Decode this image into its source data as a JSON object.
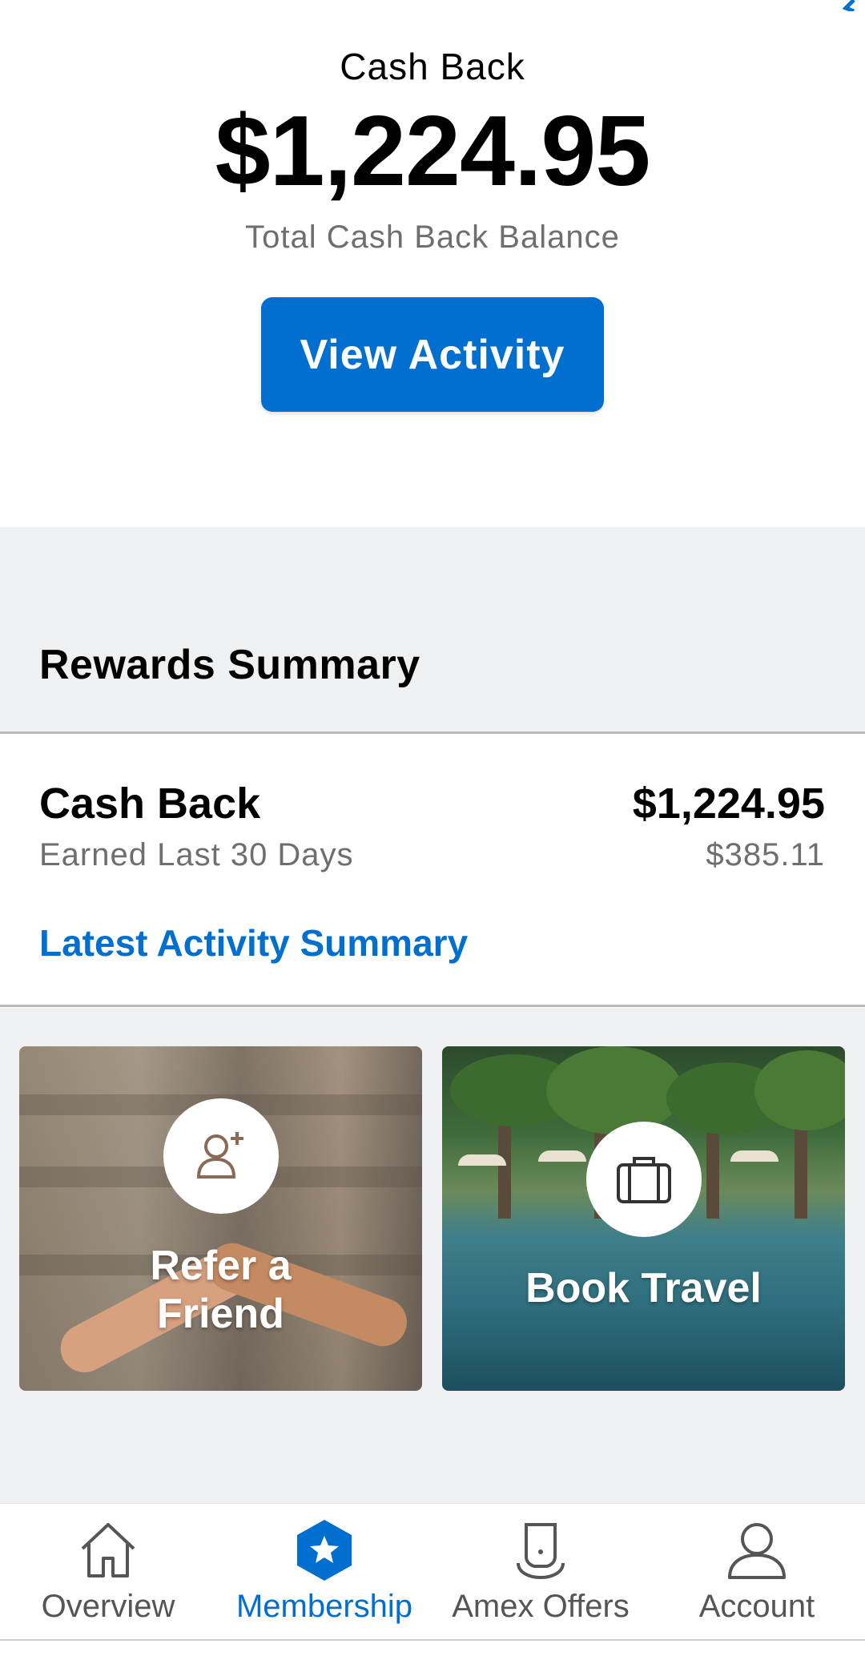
{
  "header": {
    "title": "Cash Back",
    "balance": "$1,224.95",
    "balance_caption": "Total Cash Back Balance",
    "view_activity_label": "View Activity"
  },
  "rewards_summary": {
    "title": "Rewards Summary",
    "cash_back_label": "Cash Back",
    "cash_back_value": "$1,224.95",
    "earned_label": "Earned Last 30 Days",
    "earned_value": "$385.11",
    "link_label": "Latest Activity Summary"
  },
  "tiles": [
    {
      "label_line1": "Refer a",
      "label_line2": "Friend",
      "icon": "add-user-icon"
    },
    {
      "label": "Book Travel",
      "icon": "suitcase-icon"
    }
  ],
  "tabbar": {
    "items": [
      {
        "label": "Overview",
        "icon": "home-icon",
        "active": false
      },
      {
        "label": "Membership",
        "icon": "star-badge-icon",
        "active": true
      },
      {
        "label": "Amex Offers",
        "icon": "offer-tag-icon",
        "active": false
      },
      {
        "label": "Account",
        "icon": "user-icon",
        "active": false
      }
    ]
  },
  "colors": {
    "accent": "#006fcf",
    "secondary_text": "#6e6e6e",
    "band_background": "#eff0f2"
  }
}
